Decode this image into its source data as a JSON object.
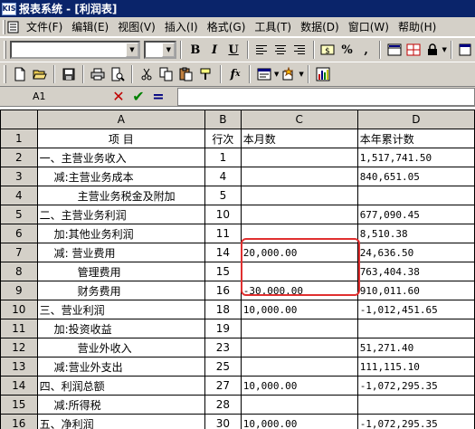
{
  "window": {
    "title": "报表系统 - [利润表]",
    "icon": "KIS"
  },
  "menu": {
    "items": [
      {
        "label": "文件(F)"
      },
      {
        "label": "编辑(E)"
      },
      {
        "label": "视图(V)"
      },
      {
        "label": "插入(I)"
      },
      {
        "label": "格式(G)"
      },
      {
        "label": "工具(T)"
      },
      {
        "label": "数据(D)"
      },
      {
        "label": "窗口(W)"
      },
      {
        "label": "帮助(H)"
      }
    ]
  },
  "toolbar1": {
    "font_value": "",
    "size_value": "",
    "bold": "B",
    "italic": "I",
    "underline": "U",
    "percent": "%",
    "comma": ","
  },
  "toolbar2": {
    "fx": "f"
  },
  "formula_bar": {
    "cell_ref": "A1",
    "cancel": "✕",
    "ok": "✔",
    "equals": "=",
    "value": ""
  },
  "sheet": {
    "col_headers": [
      "A",
      "B",
      "C",
      "D"
    ],
    "header_row": {
      "num": "1",
      "a": "项        目",
      "b": "行次",
      "c": "本月数",
      "d": "本年累计数"
    },
    "rows": [
      {
        "num": "2",
        "a": "一、主营业务收入",
        "indent": 0,
        "b": "1",
        "c": "",
        "d": "1,517,741.50"
      },
      {
        "num": "3",
        "a": "减:主营业务成本",
        "indent": 1,
        "b": "4",
        "c": "",
        "d": "840,651.05"
      },
      {
        "num": "4",
        "a": "主营业务税金及附加",
        "indent": 3,
        "b": "5",
        "c": "",
        "d": ""
      },
      {
        "num": "5",
        "a": "二、主营业务利润",
        "indent": 0,
        "b": "10",
        "c": "",
        "d": "677,090.45"
      },
      {
        "num": "6",
        "a": "加:其他业务利润",
        "indent": 1,
        "b": "11",
        "c": "",
        "d": "8,510.38"
      },
      {
        "num": "7",
        "a": "减: 营业费用",
        "indent": 1,
        "b": "14",
        "c": "20,000.00",
        "d": "24,636.50"
      },
      {
        "num": "8",
        "a": "管理费用",
        "indent": 3,
        "b": "15",
        "c": "",
        "d": "763,404.38"
      },
      {
        "num": "9",
        "a": "财务费用",
        "indent": 3,
        "b": "16",
        "c": "-30,000.00",
        "d": "910,011.60"
      },
      {
        "num": "10",
        "a": "三、营业利润",
        "indent": 0,
        "b": "18",
        "c": "10,000.00",
        "d": "-1,012,451.65"
      },
      {
        "num": "11",
        "a": "加:投资收益",
        "indent": 1,
        "b": "19",
        "c": "",
        "d": ""
      },
      {
        "num": "12",
        "a": "营业外收入",
        "indent": 3,
        "b": "23",
        "c": "",
        "d": "51,271.40"
      },
      {
        "num": "13",
        "a": "减:营业外支出",
        "indent": 1,
        "b": "25",
        "c": "",
        "d": "111,115.10"
      },
      {
        "num": "14",
        "a": "四、利润总额",
        "indent": 0,
        "b": "27",
        "c": "10,000.00",
        "d": "-1,072,295.35"
      },
      {
        "num": "15",
        "a": "减:所得税",
        "indent": 1,
        "b": "28",
        "c": "",
        "d": ""
      },
      {
        "num": "16",
        "a": "五、净利润",
        "indent": 0,
        "b": "30",
        "c": "10,000.00",
        "d": "-1,072,295.35"
      }
    ]
  },
  "colors": {
    "title_bar": "#0a246a",
    "chrome": "#d4d0c8",
    "highlight": "#e03030"
  }
}
